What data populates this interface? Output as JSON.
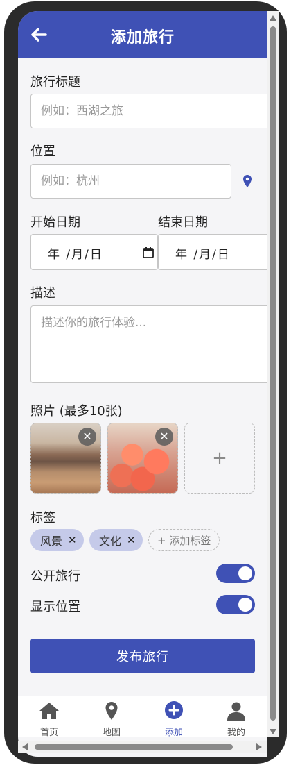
{
  "header": {
    "title": "添加旅行",
    "back_icon": "arrow-left-icon"
  },
  "form": {
    "title_label": "旅行标题",
    "title_placeholder": "例如：西湖之旅",
    "location_label": "位置",
    "location_placeholder": "例如：杭州",
    "location_icon": "map-pin-icon",
    "start_date_label": "开始日期",
    "end_date_label": "结束日期",
    "start_date_value": "年 /月/日",
    "end_date_value": "年 /月/日",
    "description_label": "描述",
    "description_placeholder": "描述你的旅行体验...",
    "photos_label": "照片 (最多10张)",
    "photo_remove": "✕",
    "add_photo": "+",
    "tags_label": "标签",
    "tags": [
      "风景",
      "文化"
    ],
    "tag_remove": "✕",
    "add_tag": "+ 添加标签",
    "public_label": "公开旅行",
    "public_on": true,
    "show_location_label": "显示位置",
    "show_location_on": true,
    "publish_button": "发布旅行"
  },
  "tabbar": {
    "items": [
      {
        "label": "首页",
        "icon": "home-icon",
        "active": false
      },
      {
        "label": "地图",
        "icon": "map-pin-icon",
        "active": false
      },
      {
        "label": "添加",
        "icon": "add-circle-icon",
        "active": true
      },
      {
        "label": "我的",
        "icon": "user-icon",
        "active": false
      }
    ]
  },
  "colors": {
    "primary": "#3f51b5",
    "chip": "#c5cae9",
    "background": "#f5f5f7"
  }
}
